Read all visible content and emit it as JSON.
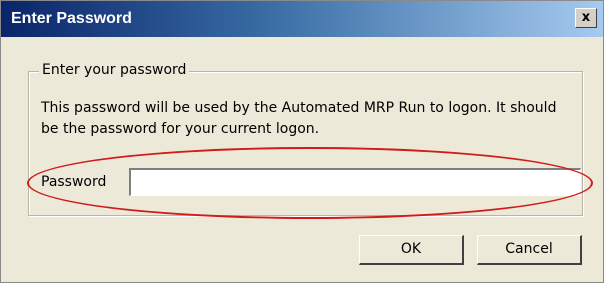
{
  "window": {
    "title": "Enter Password",
    "close_label": "x"
  },
  "group": {
    "legend": "Enter your password",
    "description": "This password will be used by the Automated MRP Run to logon.  It should be the password for your current logon."
  },
  "password": {
    "label": "Password",
    "value": ""
  },
  "buttons": {
    "ok_label": "OK",
    "cancel_label": "Cancel"
  },
  "colors": {
    "highlight_ellipse": "#d11a1a",
    "titlebar_start": "#0a246a",
    "titlebar_end": "#a6caf0"
  }
}
